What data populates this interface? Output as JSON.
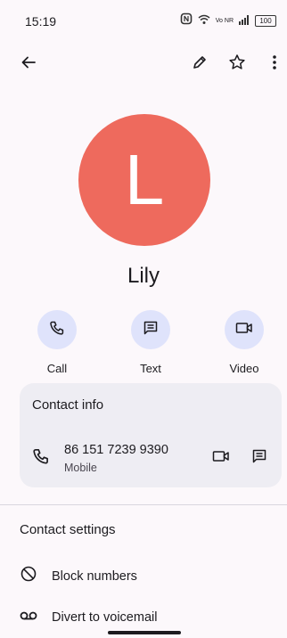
{
  "status_bar": {
    "time": "15:19",
    "network_label": "Vo NR",
    "battery": "100",
    "icons": [
      "nfc-icon",
      "wifi-icon",
      "signal-icon",
      "battery-icon"
    ]
  },
  "app_bar": {
    "icons": [
      "back-arrow-icon",
      "edit-pencil-icon",
      "star-outline-icon",
      "more-vert-icon"
    ]
  },
  "contact": {
    "initial": "L",
    "name": "Lily",
    "avatar_color": "#ee6a5d"
  },
  "actions": [
    {
      "label": "Call",
      "icon": "phone-icon"
    },
    {
      "label": "Text",
      "icon": "message-icon"
    },
    {
      "label": "Video",
      "icon": "videocam-icon"
    }
  ],
  "contact_info": {
    "title": "Contact info",
    "phone": {
      "number": "86 151 7239 9390",
      "type": "Mobile"
    }
  },
  "contact_settings": {
    "title": "Contact settings",
    "items": [
      {
        "label": "Block numbers",
        "icon": "block-icon"
      },
      {
        "label": "Divert to voicemail",
        "icon": "voicemail-icon"
      }
    ]
  },
  "colors": {
    "background": "#fcf8fb",
    "action_circle": "#dfe3fb",
    "card": "#eeedf3"
  }
}
